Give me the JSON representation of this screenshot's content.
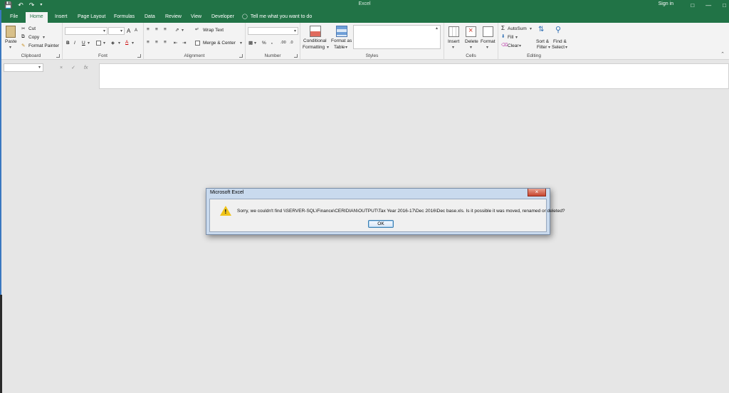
{
  "app": {
    "window_title": "Excel",
    "sign_in": "Sign in",
    "colors": {
      "brand": "#217346",
      "ribbon_bg": "#f3f3f3",
      "workspace": "#e6e6e6"
    }
  },
  "qat": {
    "save_icon": "save-icon",
    "undo_icon": "undo-icon",
    "redo_icon": "redo-icon"
  },
  "tabs": [
    {
      "label": "File"
    },
    {
      "label": "Home"
    },
    {
      "label": "Insert"
    },
    {
      "label": "Page Layout"
    },
    {
      "label": "Formulas"
    },
    {
      "label": "Data"
    },
    {
      "label": "Review"
    },
    {
      "label": "View"
    },
    {
      "label": "Developer"
    }
  ],
  "tellme": {
    "label": "Tell me what you want to do"
  },
  "ribbon": {
    "clipboard": {
      "label": "Clipboard",
      "paste": "Paste",
      "cut": "Cut",
      "copy": "Copy",
      "format_painter": "Format Painter"
    },
    "font": {
      "label": "Font",
      "bold": "B",
      "italic": "I",
      "underline": "U",
      "grow": "A",
      "shrink": "A"
    },
    "alignment": {
      "label": "Alignment",
      "wrap_text": "Wrap Text",
      "merge_center": "Merge & Center"
    },
    "number": {
      "label": "Number",
      "percent": "%",
      "comma": ",",
      "inc_dec": ".00",
      "dec_dec": ".0"
    },
    "styles": {
      "label": "Styles",
      "conditional": "Conditional",
      "formatting": "Formatting",
      "format_as": "Format as",
      "table": "Table"
    },
    "cells": {
      "label": "Cells",
      "insert": "Insert",
      "delete": "Delete",
      "format": "Format"
    },
    "editing": {
      "label": "Editing",
      "autosum": "AutoSum",
      "fill": "Fill",
      "clear": "Clear",
      "sort": "Sort &",
      "filter": "Filter",
      "find": "Find &",
      "select": "Select"
    }
  },
  "formula_bar": {
    "cancel": "×",
    "enter": "✓",
    "fx": "fx"
  },
  "dialog": {
    "title": "Microsoft Excel",
    "close": "×",
    "message": "Sorry, we couldn't find \\\\SERVER-SQL\\Finance\\CERIDIAN\\OUTPUT\\Tax Year 2016-17\\Dec 2016\\Dec base.xls. Is it possible it was moved, renamed or deleted?",
    "ok": "OK"
  }
}
